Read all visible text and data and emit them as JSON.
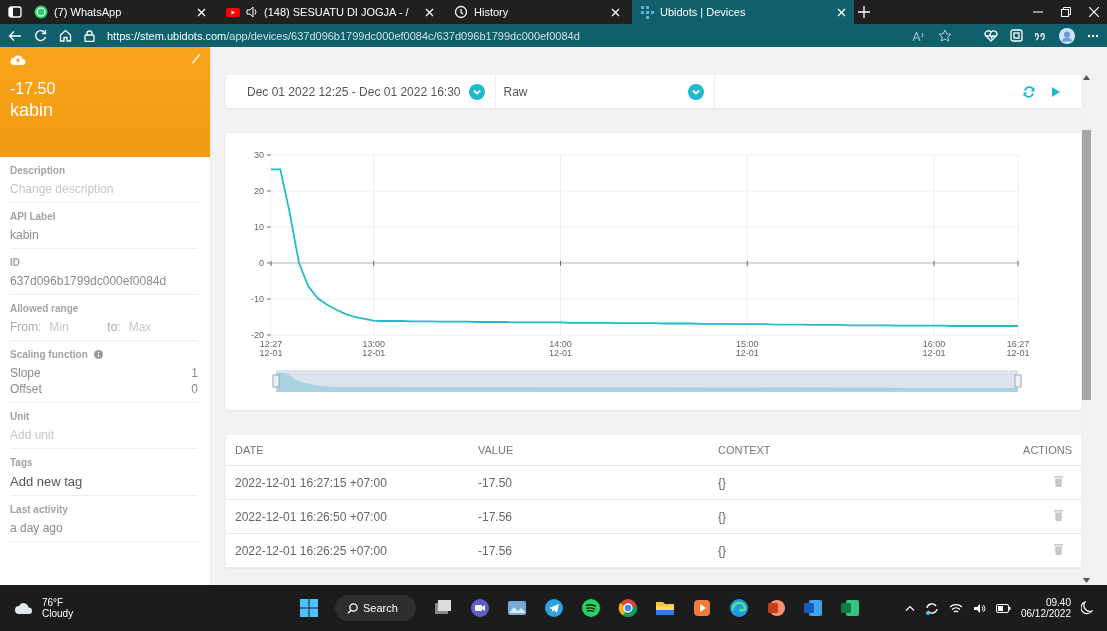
{
  "browser": {
    "tabs": [
      {
        "title": "(7) WhatsApp",
        "kind": "chat",
        "selected": false
      },
      {
        "title": "(148) SESUATU DI JOGJA - /",
        "kind": "video",
        "selected": false
      },
      {
        "title": "History",
        "kind": "history",
        "selected": false
      },
      {
        "title": "Ubidots | Devices",
        "kind": "app",
        "selected": true
      }
    ],
    "url_host": "https://stem.ubidots.com",
    "url_path": "/app/devices/637d096b1799dc000ef0084c/637d096b1799dc000ef0084d"
  },
  "variable": {
    "value": "-17.50",
    "name": "kabin",
    "fields": [
      {
        "kind": "placeholder",
        "label": "Description",
        "placeholder": "Change description"
      },
      {
        "kind": "text",
        "label": "API Label",
        "value": "kabin"
      },
      {
        "kind": "text",
        "label": "ID",
        "value": "637d096b1799dc000ef0084d"
      },
      {
        "kind": "range",
        "label": "Allowed range",
        "from_label": "From:",
        "from_placeholder": "Min",
        "to_label": "to:",
        "to_placeholder": "Max"
      },
      {
        "kind": "scaling",
        "label": "Scaling function",
        "rows": [
          {
            "name": "Slope",
            "value": "1"
          },
          {
            "name": "Offset",
            "value": "0"
          }
        ]
      },
      {
        "kind": "placeholder",
        "label": "Unit",
        "placeholder": "Add unit"
      },
      {
        "kind": "tag-input",
        "label": "Tags",
        "placeholder": "Add new tag"
      },
      {
        "kind": "text",
        "label": "Last activity",
        "value": "a day ago"
      }
    ]
  },
  "toolbar": {
    "date_range": "Dec 01 2022 12:25 - Dec 01 2022 16:30",
    "aggregation": "Raw"
  },
  "chart_data": {
    "type": "line",
    "grid": true,
    "ylim": [
      -20,
      30
    ],
    "yticks": [
      -20,
      -10,
      0,
      10,
      20,
      30
    ],
    "categories": [
      "12:27\n12-01",
      null,
      null,
      null,
      null,
      null,
      null,
      null,
      null,
      null,
      null,
      "13:00\n12-01",
      null,
      null,
      null,
      null,
      null,
      null,
      null,
      null,
      null,
      null,
      null,
      null,
      null,
      null,
      null,
      null,
      null,
      null,
      null,
      "14:00\n12-01",
      null,
      null,
      null,
      null,
      null,
      null,
      null,
      null,
      null,
      null,
      null,
      null,
      null,
      null,
      null,
      null,
      null,
      null,
      null,
      "15:00\n12-01",
      null,
      null,
      null,
      null,
      null,
      null,
      null,
      null,
      null,
      null,
      null,
      null,
      null,
      null,
      null,
      null,
      null,
      null,
      null,
      "16:00\n12-01",
      null,
      null,
      null,
      null,
      null,
      null,
      null,
      null,
      "16:27\n12-01"
    ],
    "series": [
      {
        "color": "#1fbccb",
        "values": [
          26,
          26,
          14,
          0,
          -6.5,
          -9.8,
          -11.6,
          -13,
          -14.2,
          -15,
          -15.5,
          -16.0,
          -16.1,
          -16.1,
          -16.1,
          -16.2,
          -16.2,
          -16.2,
          -16.3,
          -16.3,
          -16.3,
          -16.3,
          -16.4,
          -16.4,
          -16.4,
          -16.4,
          -16.5,
          -16.5,
          -16.5,
          -16.5,
          -16.5,
          -16.5,
          -16.6,
          -16.6,
          -16.6,
          -16.6,
          -16.6,
          -16.7,
          -16.7,
          -16.7,
          -16.7,
          -16.7,
          -16.8,
          -16.8,
          -16.8,
          -16.8,
          -16.9,
          -16.9,
          -16.9,
          -16.9,
          -17.0,
          -17.0,
          -17.0,
          -17.0,
          -17.1,
          -17.1,
          -17.1,
          -17.1,
          -17.2,
          -17.2,
          -17.2,
          -17.2,
          -17.3,
          -17.3,
          -17.3,
          -17.3,
          -17.3,
          -17.4,
          -17.4,
          -17.4,
          -17.4,
          -17.4,
          -17.4,
          -17.5,
          -17.5,
          -17.5,
          -17.5,
          -17.5,
          -17.5,
          -17.5,
          -17.5
        ]
      }
    ]
  },
  "table": {
    "columns": [
      "DATE",
      "VALUE",
      "CONTEXT",
      "ACTIONS"
    ],
    "rows": [
      {
        "date": "2022-12-01 16:27:15 +07:00",
        "value": "-17.50",
        "context": "{}"
      },
      {
        "date": "2022-12-01 16:26:50 +07:00",
        "value": "-17.56",
        "context": "{}"
      },
      {
        "date": "2022-12-01 16:26:25 +07:00",
        "value": "-17.56",
        "context": "{}"
      }
    ]
  },
  "taskbar": {
    "temperature": "76°F",
    "weather": "Cloudy",
    "search": "Search",
    "time": "09.40",
    "date": "06/12/2022"
  }
}
